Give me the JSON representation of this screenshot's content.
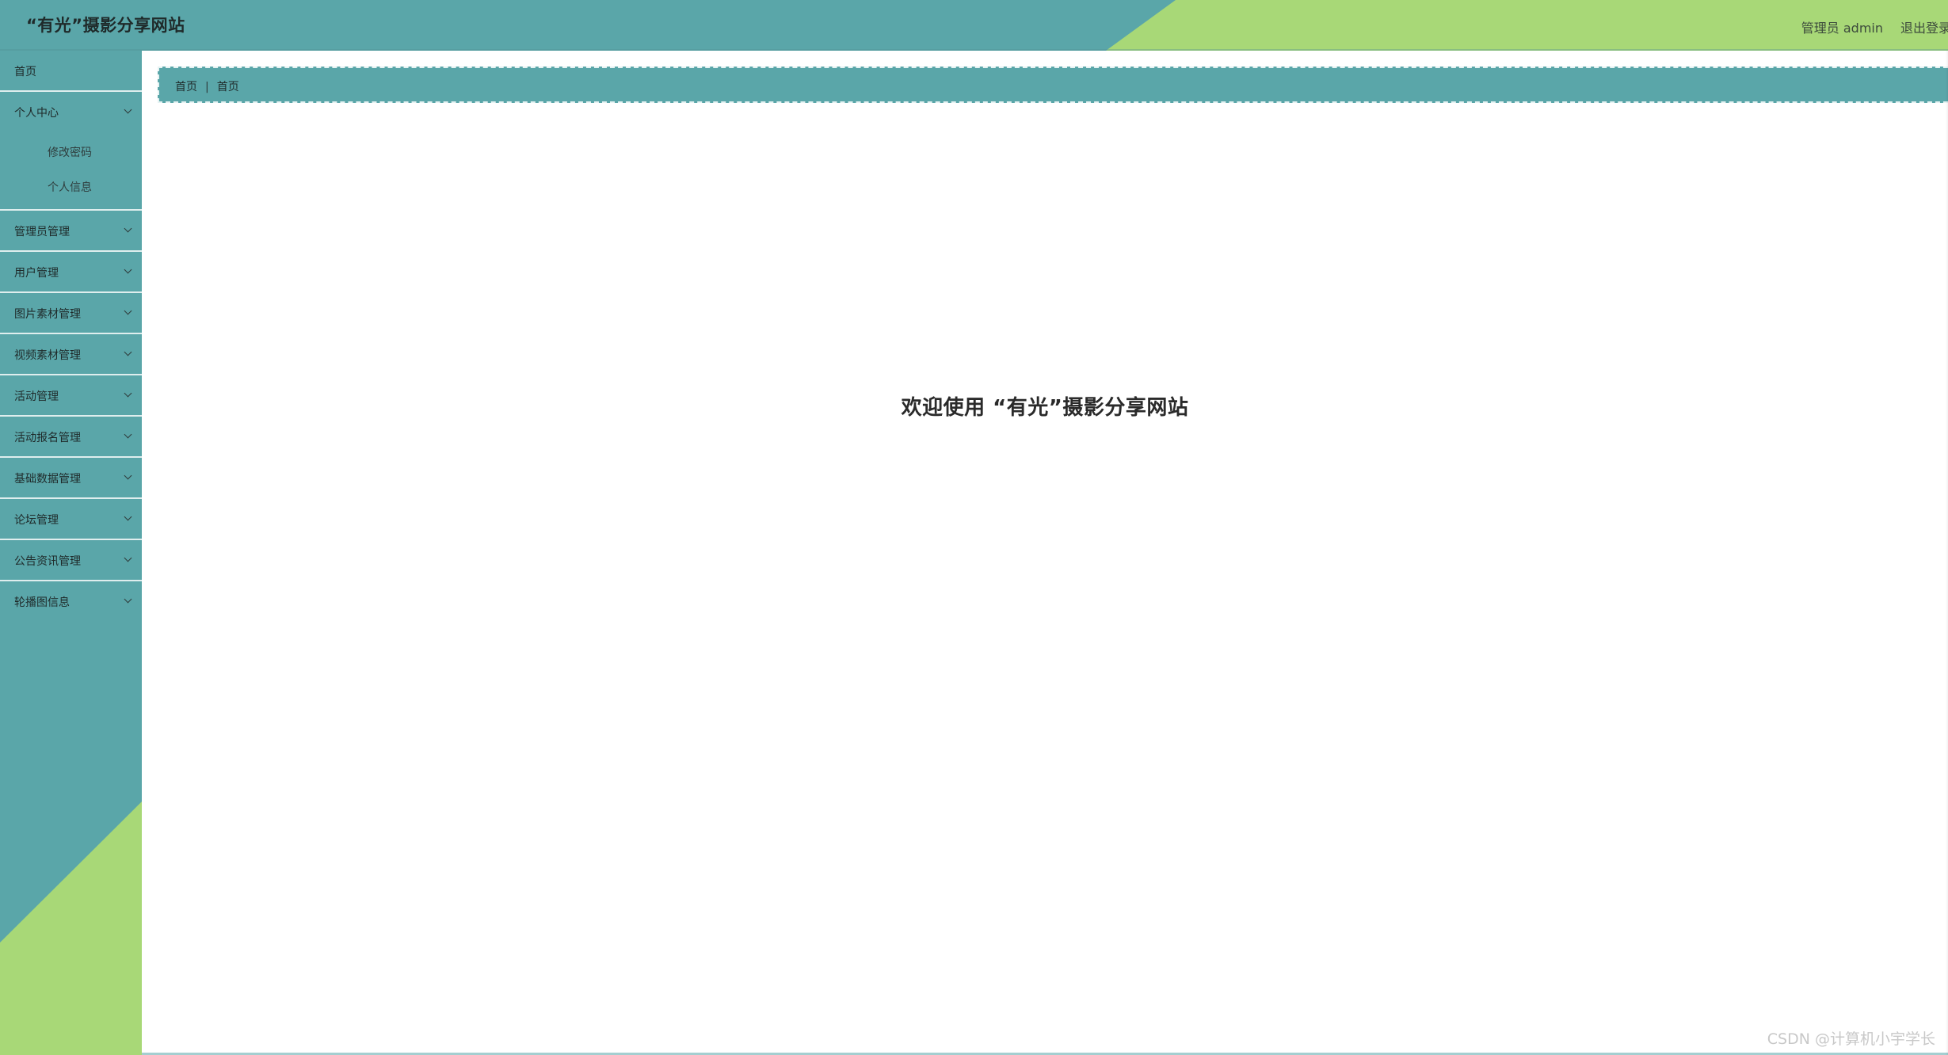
{
  "header": {
    "site_title": "“有光”摄影分享网站",
    "user_label": "管理员 admin",
    "logout_label": "退出登录"
  },
  "sidebar": {
    "home": "首页",
    "personal_center": {
      "label": "个人中心",
      "children": [
        "修改密码",
        "个人信息"
      ]
    },
    "items": [
      "管理员管理",
      "用户管理",
      "图片素材管理",
      "视频素材管理",
      "活动管理",
      "活动报名管理",
      "基础数据管理",
      "论坛管理",
      "公告资讯管理",
      "轮播图信息"
    ]
  },
  "breadcrumb": {
    "items": [
      "首页",
      "首页"
    ]
  },
  "main": {
    "welcome_text": "欢迎使用 “有光”摄影分享网站"
  },
  "watermark": "CSDN @计算机小宇学长",
  "colors": {
    "primary_teal": "#5aa6a9",
    "accent_green": "#a8d877"
  }
}
